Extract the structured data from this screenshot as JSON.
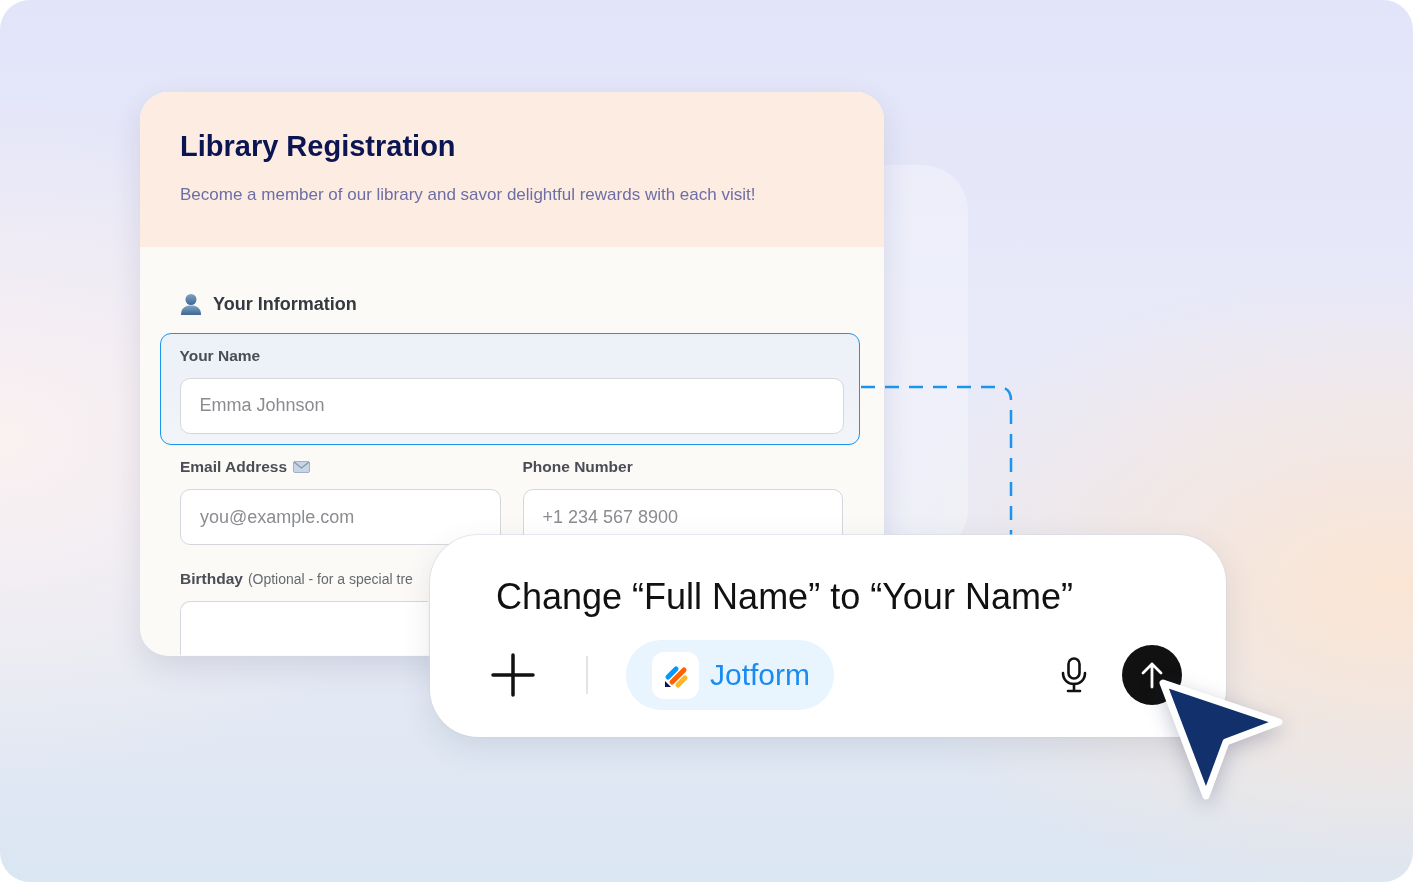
{
  "form": {
    "title": "Library Registration",
    "subtitle": "Become a member of our library and savor delightful rewards with each visit!",
    "section": {
      "title": "Your Information"
    },
    "fields": [
      {
        "kind": "name",
        "label": "Your Name",
        "placeholder": "Emma Johnson",
        "selected": true
      },
      {
        "kind": "email",
        "label": "Email Address",
        "placeholder": "you@example.com",
        "selected": false
      },
      {
        "kind": "phone",
        "label": "Phone Number",
        "placeholder": "+1 234 567 8900",
        "selected": false
      },
      {
        "kind": "date",
        "label": "Birthday",
        "hint": "(Optional - for a special tre",
        "selected": false
      }
    ]
  },
  "composer": {
    "value": "Change “Full Name” to “Your Name”",
    "chip": {
      "label": "Jotform"
    }
  }
}
